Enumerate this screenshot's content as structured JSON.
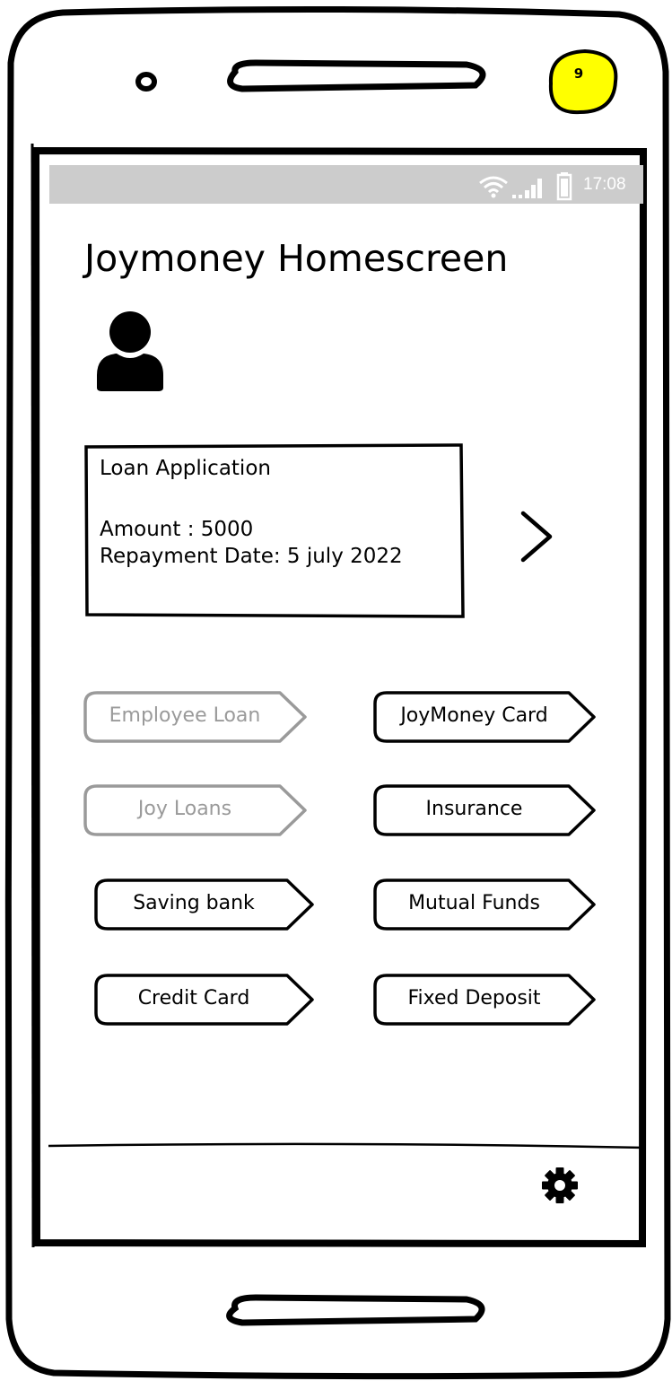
{
  "device": {
    "badge": "9"
  },
  "status_bar": {
    "time": "17:08",
    "icons": [
      "wifi-icon",
      "signal-icon",
      "battery-icon"
    ]
  },
  "screen": {
    "title": "Joymoney Homescreen",
    "avatar_icon": "user-avatar-icon",
    "loan_card": {
      "heading": "Loan Application",
      "amount": "Amount : 5000",
      "repayment": "Repayment Date: 5 july 2022",
      "open_icon": "chevron-right-icon"
    },
    "tags": [
      {
        "label": "Employee Loan",
        "enabled": false
      },
      {
        "label": "JoyMoney Card",
        "enabled": true
      },
      {
        "label": "Joy Loans",
        "enabled": false
      },
      {
        "label": "Insurance",
        "enabled": true
      },
      {
        "label": "Saving bank",
        "enabled": true
      },
      {
        "label": "Mutual Funds",
        "enabled": true
      },
      {
        "label": "Credit Card",
        "enabled": true
      },
      {
        "label": "Fixed Deposit",
        "enabled": true
      }
    ],
    "bottom_bar": {
      "settings_icon": "gear-icon"
    }
  },
  "colors": {
    "badge": "#ffff00",
    "status_bar": "#cccccc",
    "disabled_text": "#9a9a9a"
  }
}
